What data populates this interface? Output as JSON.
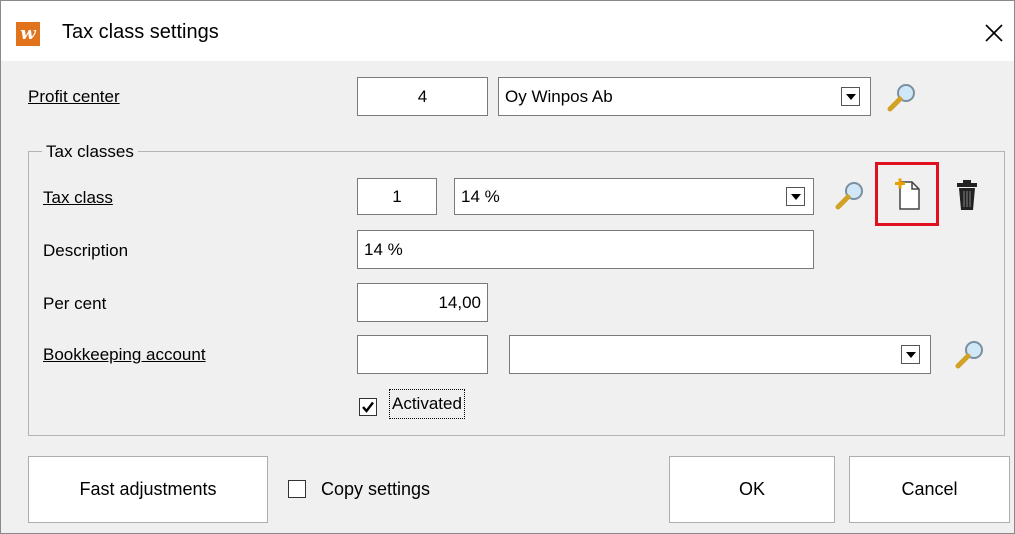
{
  "window": {
    "title": "Tax class settings",
    "app_icon_letter": "w"
  },
  "profit_center": {
    "label": "Profit center",
    "code": "4",
    "name": "Oy Winpos Ab"
  },
  "tax_classes": {
    "group_title": "Tax classes",
    "tax_class_label": "Tax class",
    "tax_class_code": "1",
    "tax_class_name": "14 %",
    "description_label": "Description",
    "description_value": "14 %",
    "per_cent_label": "Per cent",
    "per_cent_value": "14,00",
    "bookkeeping_label": "Bookkeeping account",
    "bookkeeping_code": "",
    "bookkeeping_name": "",
    "activated_label": "Activated",
    "activated_checked": true
  },
  "footer": {
    "fast_adjustments": "Fast adjustments",
    "copy_settings_label": "Copy settings",
    "copy_settings_checked": false,
    "ok": "OK",
    "cancel": "Cancel"
  },
  "icons": [
    "app-icon",
    "close-icon",
    "magnifier-icon",
    "new-document-icon",
    "trash-icon",
    "checkmark-icon"
  ],
  "colors": {
    "accent_orange": "#e2731d",
    "highlight_red": "#e0101e"
  }
}
